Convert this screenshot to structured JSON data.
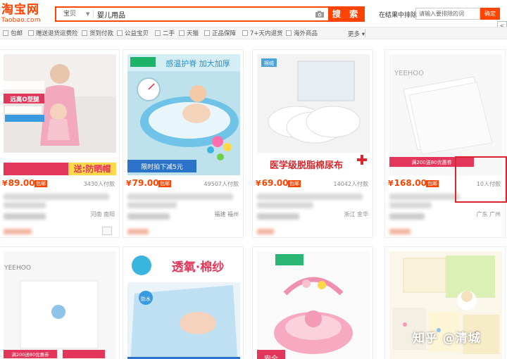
{
  "header": {
    "logo_cn": "淘宝网",
    "logo_en": "Taobao.com",
    "search_type": "宝贝",
    "search_value": "婴儿用品",
    "search_button": "搜 索",
    "exclude_label": "在结果中排除",
    "exclude_placeholder": "请输入要排除的词",
    "exclude_button": "确定"
  },
  "filters": [
    "包邮",
    "赠送退货运费险",
    "货到付款",
    "公益宝贝",
    "二手",
    "天猫",
    "正品保障",
    "7+天内退货",
    "海外商品"
  ],
  "filter_more": "更多",
  "scroll_tab": "<",
  "products": [
    {
      "price": "89.00",
      "baoyou": "包邮",
      "sold": "3430人付款",
      "location": "河南 南阳",
      "img_text": "远离O型腿",
      "img_sub": "送:防晒帽"
    },
    {
      "price": "79.00",
      "baoyou": "包邮",
      "sold": "49507人付款",
      "location": "福建 福州",
      "img_text": "感温护脊 加大加厚",
      "img_sub": "限时拍下减5元"
    },
    {
      "price": "69.00",
      "baoyou": "包邮",
      "sold": "14042人付款",
      "location": "浙江 金华",
      "img_text": "医学级脱脂棉尿布",
      "img_sub": "棉绒"
    },
    {
      "price": "168.00",
      "baoyou": "包邮",
      "sold": "10人付款",
      "location": "广东 广州",
      "img_text": "YEEHOO",
      "img_sub": "满200送80优惠券"
    },
    {
      "img_text": "YEEHOO",
      "img_sub": "满200送80优惠券"
    },
    {
      "img_text": "透氧·棉纱",
      "img_sub": "防水"
    },
    {
      "img_text": "安全",
      "img_sub": ""
    },
    {
      "img_text": "",
      "img_sub": ""
    }
  ],
  "watermark": "知乎 @清城",
  "colors": {
    "accent": "#ff4400",
    "highlight": "#d9272e"
  }
}
